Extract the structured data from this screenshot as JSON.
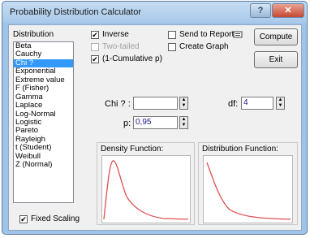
{
  "window": {
    "title": "Probability Distribution Calculator",
    "help_icon": "question-mark",
    "close_icon": "x"
  },
  "distribution": {
    "label": "Distribution",
    "items": [
      "Beta",
      "Cauchy",
      "Chi ?",
      "Exponential",
      "Extreme value",
      "F (Fisher)",
      "Gamma",
      "Laplace",
      "Log-Normal",
      "Logistic",
      "Pareto",
      "Rayleigh",
      "t (Student)",
      "Weibull",
      "Z (Normal)"
    ],
    "selected_index": 2
  },
  "options": {
    "inverse": {
      "label": "Inverse",
      "checked": true
    },
    "two_tailed": {
      "label": "Two-tailed",
      "checked": false,
      "enabled": false
    },
    "one_minus_cumulative": {
      "label": "(1-Cumulative p)",
      "checked": true
    },
    "send_to_report": {
      "label": "Send to Report",
      "checked": false,
      "icon": "report-icon"
    },
    "create_graph": {
      "label": "Create Graph",
      "checked": false
    },
    "fixed_scaling": {
      "label": "Fixed Scaling",
      "checked": true
    }
  },
  "buttons": {
    "compute": "Compute",
    "exit": "Exit"
  },
  "params": {
    "chi_label": "Chi ? :",
    "chi_value": "",
    "df_label": "df:",
    "df_value": "4",
    "p_label": "p:",
    "p_value": "0,95"
  },
  "plots": {
    "density_title": "Density Function:",
    "distribution_title": "Distribution Function:",
    "curve_color": "#e05050"
  }
}
